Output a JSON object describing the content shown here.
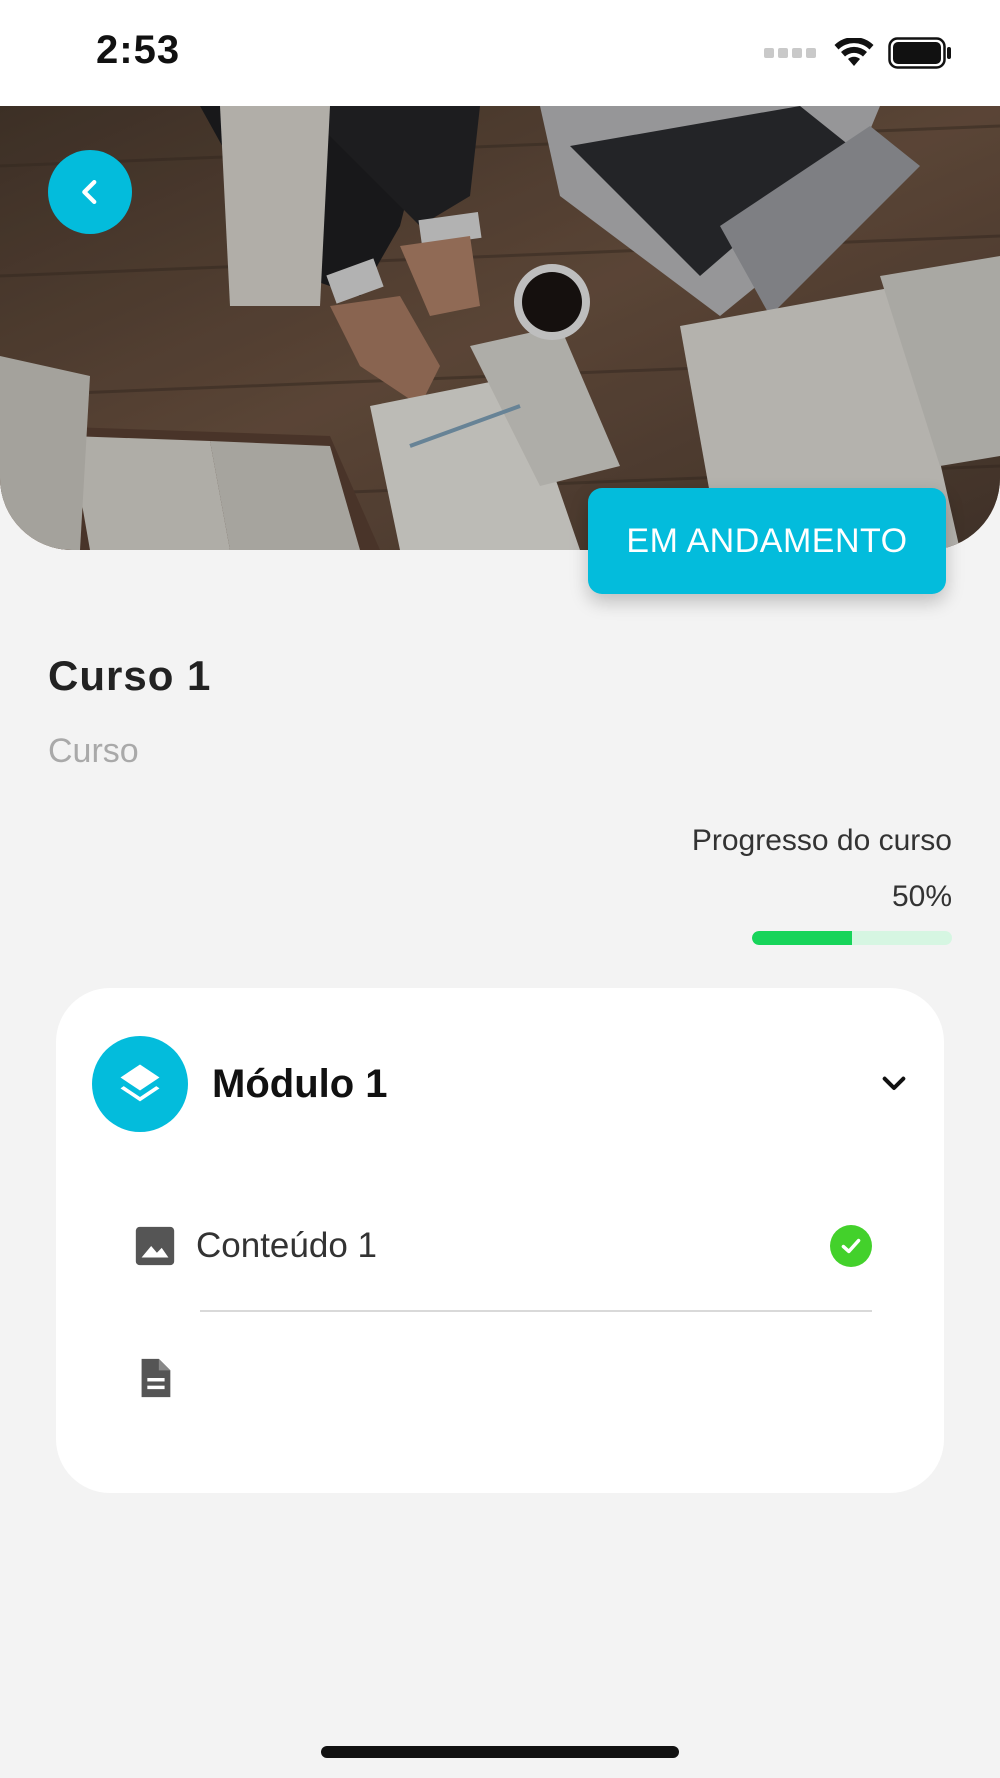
{
  "status_bar": {
    "time": "2:53",
    "icons": [
      "signal-icon",
      "wifi-icon",
      "battery-icon"
    ]
  },
  "hero": {
    "image": "business-meeting-photo",
    "back_icon": "chevron-left-icon"
  },
  "status_chip": {
    "label": "EM ANDAMENTO"
  },
  "course": {
    "title": "Curso 1",
    "type": "Curso",
    "progress_label": "Progresso do curso",
    "progress_text": "50%",
    "progress_fraction": 0.5
  },
  "module": {
    "title": "Módulo 1",
    "icon": "layers-icon",
    "expand_icon": "chevron-down-icon",
    "items": [
      {
        "label": "Conteúdo 1",
        "icon": "image-icon",
        "completed": true
      },
      {
        "label": "",
        "icon": "document-icon",
        "completed": false
      }
    ]
  },
  "colors": {
    "accent": "#03bcdc",
    "progress_fill": "#17d45a",
    "progress_track": "#d6f6e2",
    "check": "#43d12b",
    "background": "#f3f3f3"
  }
}
